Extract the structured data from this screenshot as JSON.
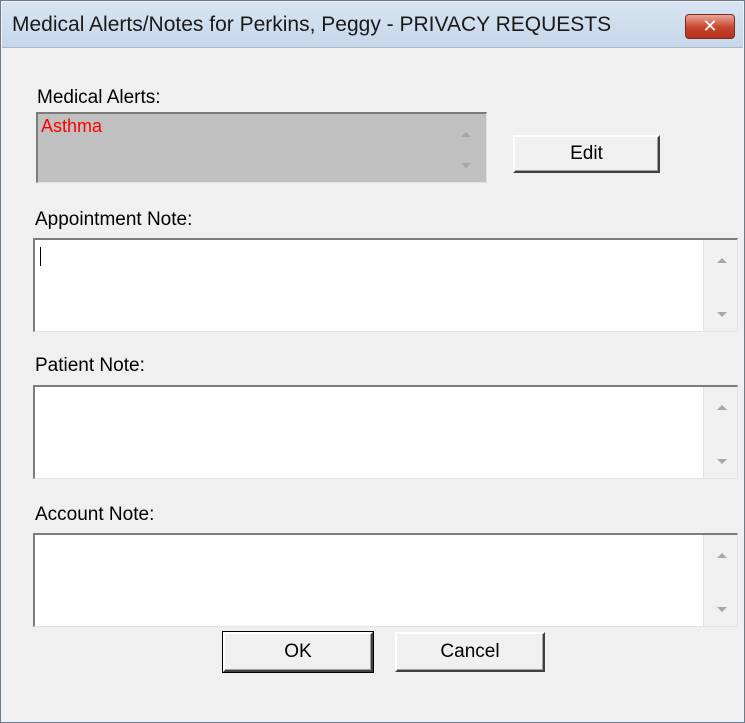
{
  "window": {
    "title": "Medical Alerts/Notes for Perkins, Peggy - PRIVACY REQUESTS",
    "close_label": "✕"
  },
  "medical_alerts": {
    "label": "Medical Alerts:",
    "value": "Asthma",
    "value_color": "#ff0000",
    "edit_label": "Edit"
  },
  "appointment_note": {
    "label": "Appointment Note:",
    "value": ""
  },
  "patient_note": {
    "label": "Patient Note:",
    "value": ""
  },
  "account_note": {
    "label": "Account Note:",
    "value": ""
  },
  "buttons": {
    "ok_label": "OK",
    "cancel_label": "Cancel"
  }
}
